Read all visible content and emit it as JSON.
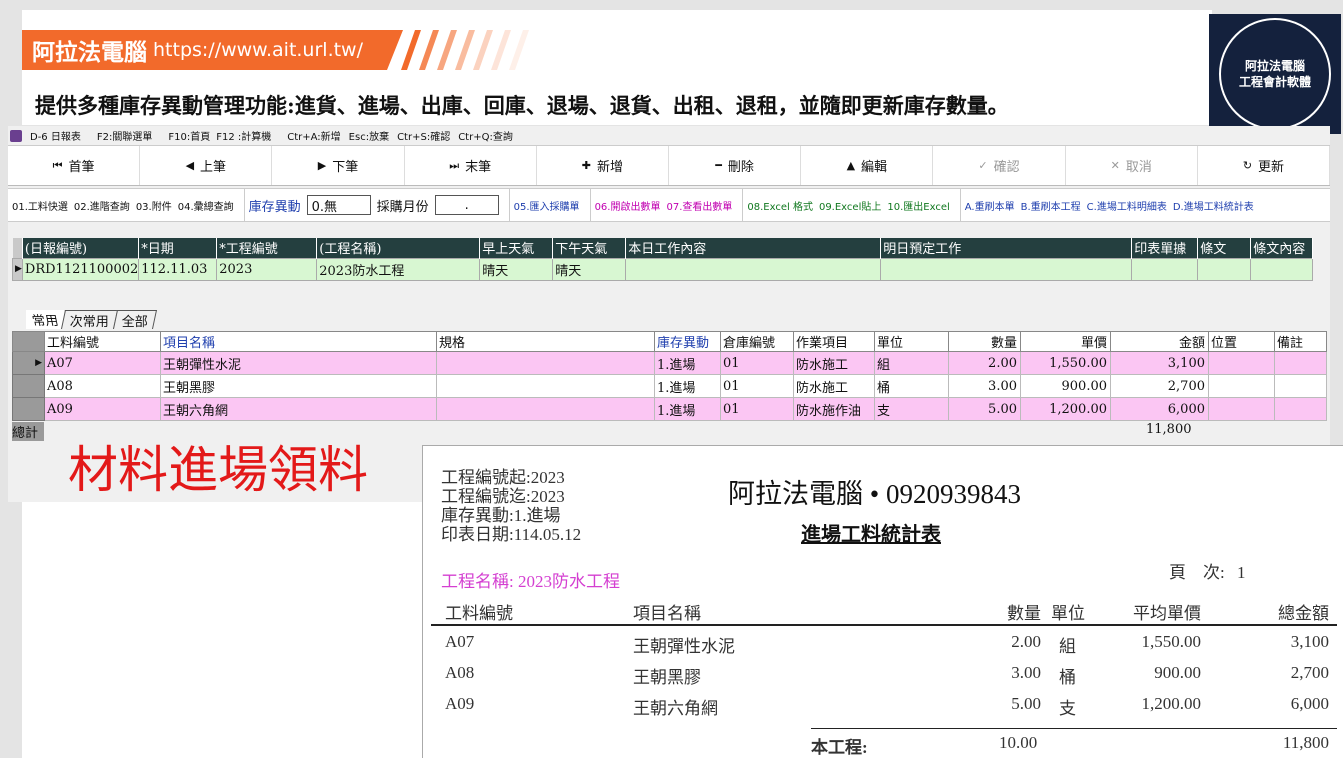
{
  "banner": {
    "brand_name": "阿拉法電腦",
    "brand_url": "https://www.ait.url.tw/",
    "tagline": "提供多種庫存異動管理功能:進貨、進場、出庫、回庫、退場、退貨、出租、退租，並隨即更新庫存數量。",
    "logo_line1": "阿拉法電腦",
    "logo_line2": "工程會計軟體",
    "colors": {
      "orange": "#f26a2b",
      "navy": "#14213d"
    }
  },
  "window": {
    "title": "D-6 日報表",
    "shortcuts": [
      "F2:關聯選單",
      "F10:首頁",
      "F12 :計算機",
      "Ctr+A:新增",
      "Esc:放棄",
      "Ctr+S:確認",
      "Ctr+Q:查詢"
    ]
  },
  "toolbar": {
    "first": "首筆",
    "prev": "上筆",
    "next": "下筆",
    "last": "末筆",
    "add": "新增",
    "delete": "刪除",
    "edit": "編輯",
    "confirm": "確認",
    "cancel": "取消",
    "refresh": "更新"
  },
  "funcbar": {
    "query1": "01.工料快選",
    "query2": "02.進階查詢",
    "query3": "03.附件",
    "query4": "04.彙總查詢",
    "stock_label": "庫存異動",
    "stock_value": "0.無",
    "month_label": "採購月份",
    "month_value": " . ",
    "import_po": "05.匯入採購單",
    "open_out": "06.開啟出數單",
    "view_out": "07.查看出數單",
    "excel_fmt": "08.Excel 格式",
    "excel_paste": "09.Excel貼上",
    "excel_export": "10.匯出Excel",
    "a_refresh": "A.重刷本單",
    "b_refresh": "B.重刷本工程",
    "c_detail": "C.進場工料明細表",
    "d_stats": "D.進場工料統計表"
  },
  "daily": {
    "headers": [
      "(日報編號)",
      "*日期",
      "*工程編號",
      "(工程名稱)",
      "早上天氣",
      "下午天氣",
      "本日工作內容",
      "明日預定工作",
      "印表單據",
      "條文",
      "條文內容"
    ],
    "row": [
      "DRD1121100002",
      "112.11.03",
      "2023",
      "2023防水工程",
      "晴天",
      "晴天",
      "",
      "",
      "",
      "",
      ""
    ]
  },
  "tabs": [
    "常用",
    "次常用",
    "全部"
  ],
  "items": {
    "headers": [
      "工料編號",
      "項目名稱",
      "規格",
      "庫存異動",
      "倉庫編號",
      "作業項目",
      "單位",
      "數量",
      "單價",
      "金額",
      "位置",
      "備註"
    ],
    "rows": [
      [
        "A07",
        "王朝彈性水泥",
        "",
        "1.進場",
        "01",
        "防水施工",
        "組",
        "2.00",
        "1,550.00",
        "3,100",
        "",
        ""
      ],
      [
        "A08",
        "王朝黑膠",
        "",
        "1.進場",
        "01",
        "防水施工",
        "桶",
        "3.00",
        "900.00",
        "2,700",
        "",
        ""
      ],
      [
        "A09",
        "王朝六角網",
        "",
        "1.進場",
        "01",
        "防水施作油",
        "支",
        "5.00",
        "1,200.00",
        "6,000",
        "",
        ""
      ]
    ],
    "total_label": "總計",
    "total_amount": "11,800"
  },
  "caption": "材料進場領料",
  "report": {
    "meta": [
      "工程編號起:2023",
      "工程編號迄:2023",
      "庫存異動:1.進場",
      "印表日期:114.05.12"
    ],
    "company": "阿拉法電腦 • 0920939843",
    "title": "進場工料統計表",
    "page_label": "頁　次:",
    "page_no": "1",
    "project": "工程名稱: 2023防水工程",
    "headers": [
      "工料編號",
      "項目名稱",
      "數量",
      "單位",
      "平均單價",
      "總金額"
    ],
    "rows": [
      [
        "A07",
        "王朝彈性水泥",
        "2.00",
        "組",
        "1,550.00",
        "3,100"
      ],
      [
        "A08",
        "王朝黑膠",
        "3.00",
        "桶",
        "900.00",
        "2,700"
      ],
      [
        "A09",
        "王朝六角網",
        "5.00",
        "支",
        "1,200.00",
        "6,000"
      ]
    ],
    "total_label": "本工程:",
    "total_qty": "10.00",
    "total_amount": "11,800"
  }
}
